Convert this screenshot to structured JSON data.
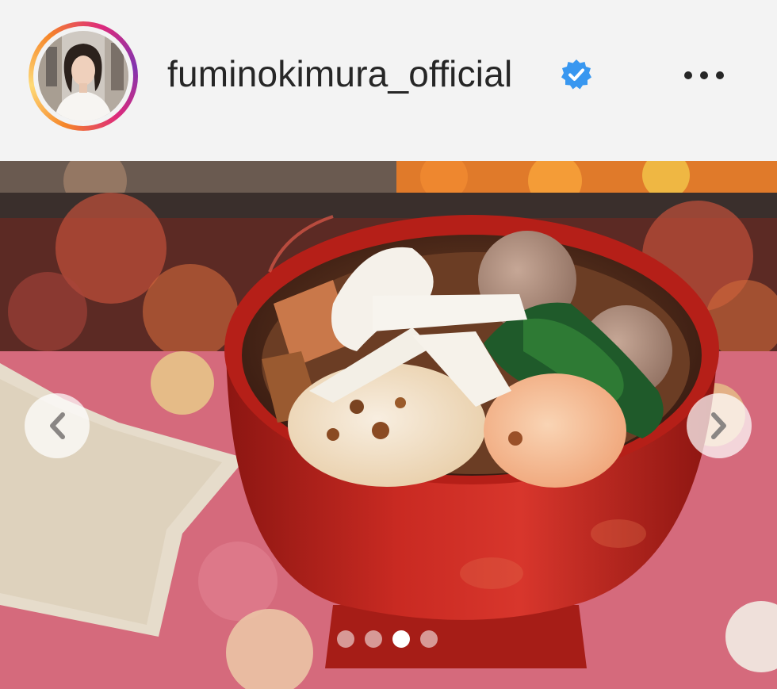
{
  "post": {
    "username": "fuminokimura_official",
    "verified": true,
    "icons": {
      "verified": "verified-badge-icon",
      "more": "more-options-icon",
      "prev": "chevron-left-icon",
      "next": "chevron-right-icon"
    },
    "carousel": {
      "total_slides": 4,
      "active_slide": 3
    },
    "colors": {
      "verified_blue": "#3897f0",
      "text": "#262626",
      "background": "#f3f3f3"
    }
  }
}
